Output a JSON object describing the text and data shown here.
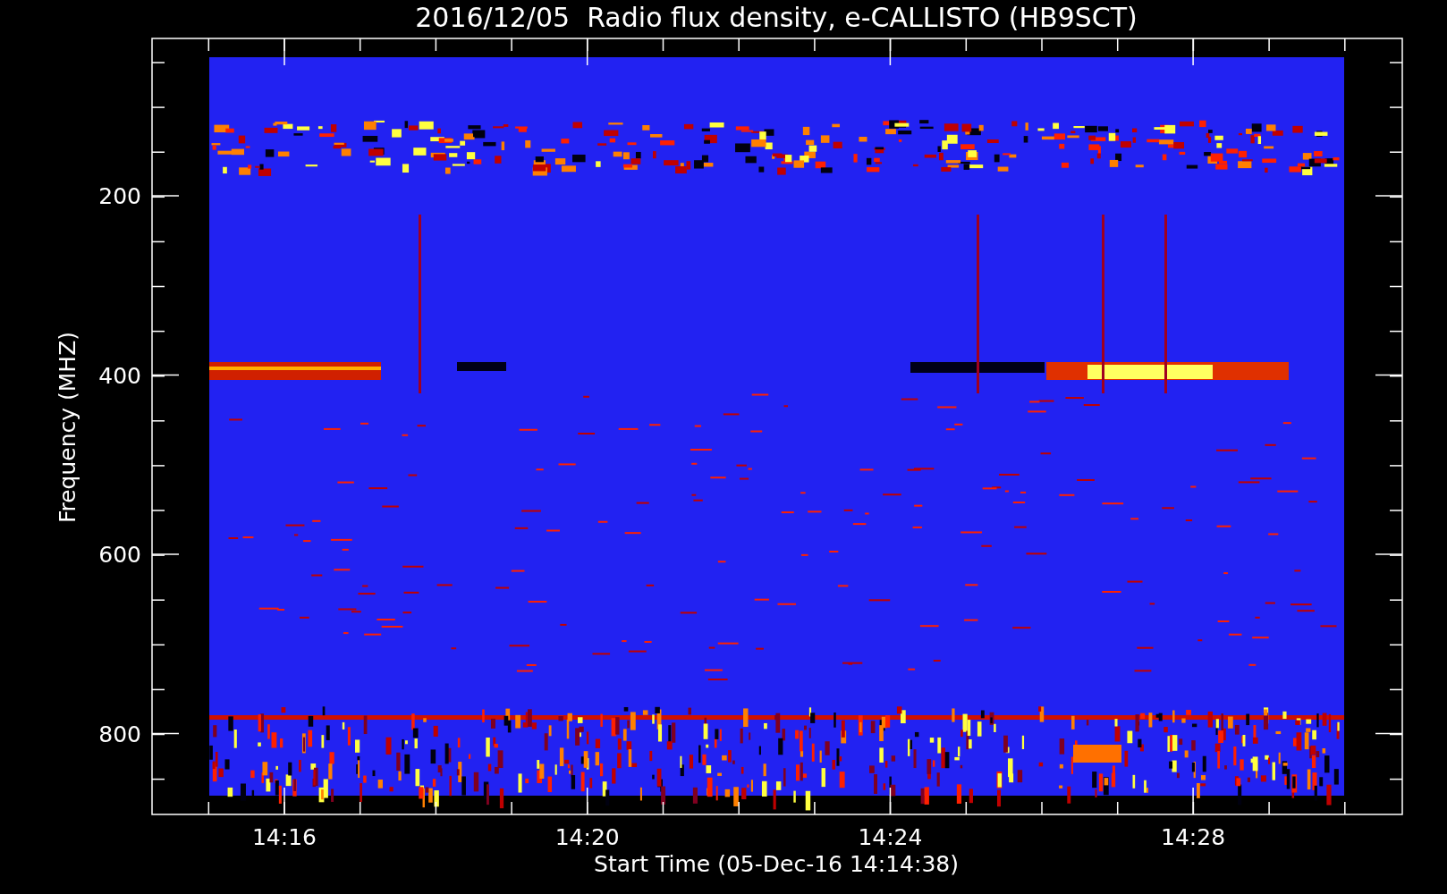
{
  "title": "2016/12/05  Radio flux density, e-CALLISTO (HB9SCT)",
  "y_axis": {
    "label": "Frequency (MHZ)",
    "ticks": [
      "200",
      "400",
      "600",
      "800"
    ]
  },
  "x_axis": {
    "label": "Start Time (05-Dec-16 14:14:38)",
    "ticks": [
      "14:16",
      "14:20",
      "14:24",
      "14:28"
    ]
  }
}
